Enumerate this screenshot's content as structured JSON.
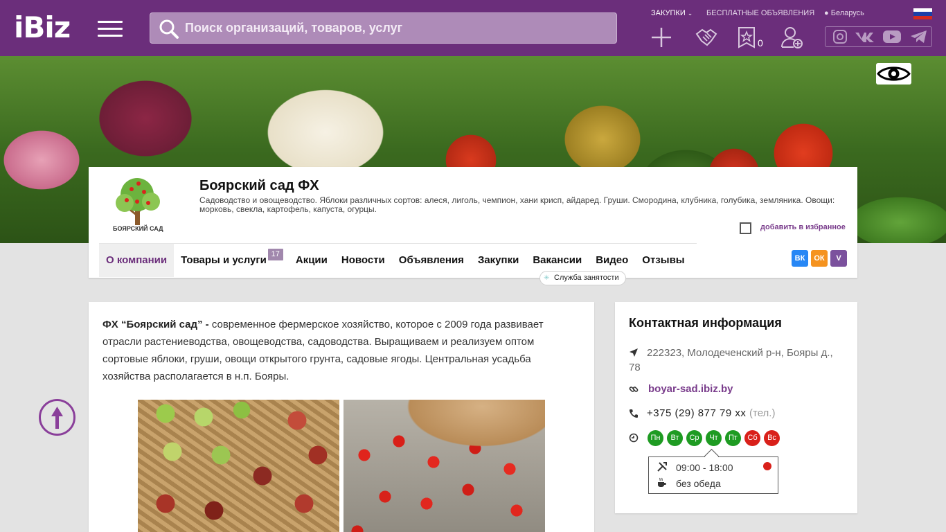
{
  "header": {
    "logo": "iBiz",
    "search_placeholder": "Поиск организаций, товаров, услуг",
    "links": {
      "purchases": "ЗАКУПКИ",
      "free_ads": "БЕСПЛАТНЫЕ ОБЪЯВЛЕНИЯ",
      "region": "Беларусь"
    },
    "favorites_count": "0",
    "icons": [
      "add-icon",
      "handshake-icon",
      "favorites-star-icon",
      "add-user-icon"
    ],
    "social": [
      "instagram-icon",
      "vk-icon",
      "youtube-icon",
      "telegram-icon"
    ]
  },
  "company": {
    "logo_text": "БОЯРСКИЙ САД",
    "name": "Боярский сад ФХ",
    "description": "Садоводство и овощеводство. Яблоки различных сортов: алеся, лиголь, чемпион, хани крисп, айдаред. Груши. Смородина, клубника, голубика, земляника. Овощи: морковь, свекла, картофель, капуста, огурцы.",
    "add_favorite": "добавить в избранное",
    "tabs": [
      {
        "label": "О компании"
      },
      {
        "label": "Товары и услуги",
        "badge": "17"
      },
      {
        "label": "Акции"
      },
      {
        "label": "Новости"
      },
      {
        "label": "Объявления"
      },
      {
        "label": "Закупки"
      },
      {
        "label": "Вакансии"
      },
      {
        "label": "Видео"
      },
      {
        "label": "Отзывы"
      }
    ],
    "job_service": "Служба занятости",
    "share": [
      "ВК",
      "ОК",
      "V"
    ]
  },
  "about": {
    "lead": "ФХ “Боярский сад” -",
    "text": " современное фермерское хозяйство, которое с 2009 года развивает отрасли растениеводства, овощеводства, садоводства. Выращиваем и реализуем оптом сортовые яблоки, груши, овощи открытого грунта, садовые ягоды. Центральная усадьба хозяйства располагается в н.п. Бояры."
  },
  "contacts": {
    "title": "Контактная информация",
    "address": "222323, Молодеченский р-н, Бояры д., 78",
    "website": "boyar-sad.ibiz.by",
    "phone": "+375 (29) 877 79 xx",
    "phone_type": "(тел.)",
    "days": [
      {
        "label": "Пн",
        "status": "on"
      },
      {
        "label": "Вт",
        "status": "on"
      },
      {
        "label": "Ср",
        "status": "on"
      },
      {
        "label": "Чт",
        "status": "on"
      },
      {
        "label": "Пт",
        "status": "on"
      },
      {
        "label": "Сб",
        "status": "off"
      },
      {
        "label": "Вс",
        "status": "off"
      }
    ],
    "hours": "09:00 - 18:00",
    "lunch": "без обеда"
  },
  "colors": {
    "brand": "#6b2e7b",
    "link": "#7a3d8c",
    "open": "#1e9b22",
    "closed": "#d9201a"
  }
}
